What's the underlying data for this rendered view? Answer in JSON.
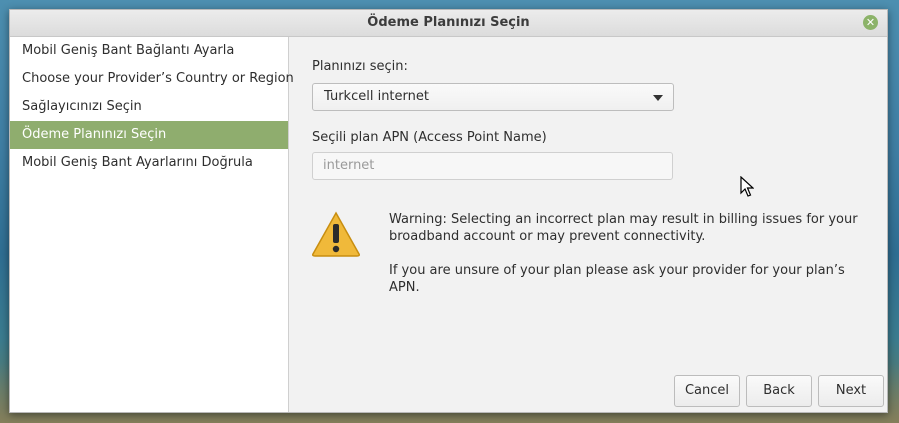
{
  "window": {
    "title": "Ödeme Planınızı Seçin",
    "close_icon": "close-icon"
  },
  "sidebar": {
    "items": [
      {
        "label": "Mobil Geniş Bant Bağlantı Ayarla",
        "active": false
      },
      {
        "label": "Choose your Provider’s Country or Region",
        "active": false
      },
      {
        "label": "Sağlayıcınızı Seçin",
        "active": false
      },
      {
        "label": "Ödeme Planınızı Seçin",
        "active": true
      },
      {
        "label": "Mobil Geniş Bant Ayarlarını Doğrula",
        "active": false
      }
    ]
  },
  "main": {
    "plan_label": "Planınızı seçin:",
    "plan_selected": "Turkcell internet",
    "apn_label": "Seçili plan APN (Access Point Name)",
    "apn_value": "internet",
    "warning_line1": "Warning: Selecting an incorrect plan may result in billing issues for your broadband account or may prevent connectivity.",
    "warning_line2": "If you are unsure of your plan please ask your provider for your plan’s APN."
  },
  "buttons": {
    "cancel": "Cancel",
    "back": "Back",
    "next": "Next"
  },
  "colors": {
    "accent": "#8fad6e",
    "warning": "#f0b93a"
  }
}
